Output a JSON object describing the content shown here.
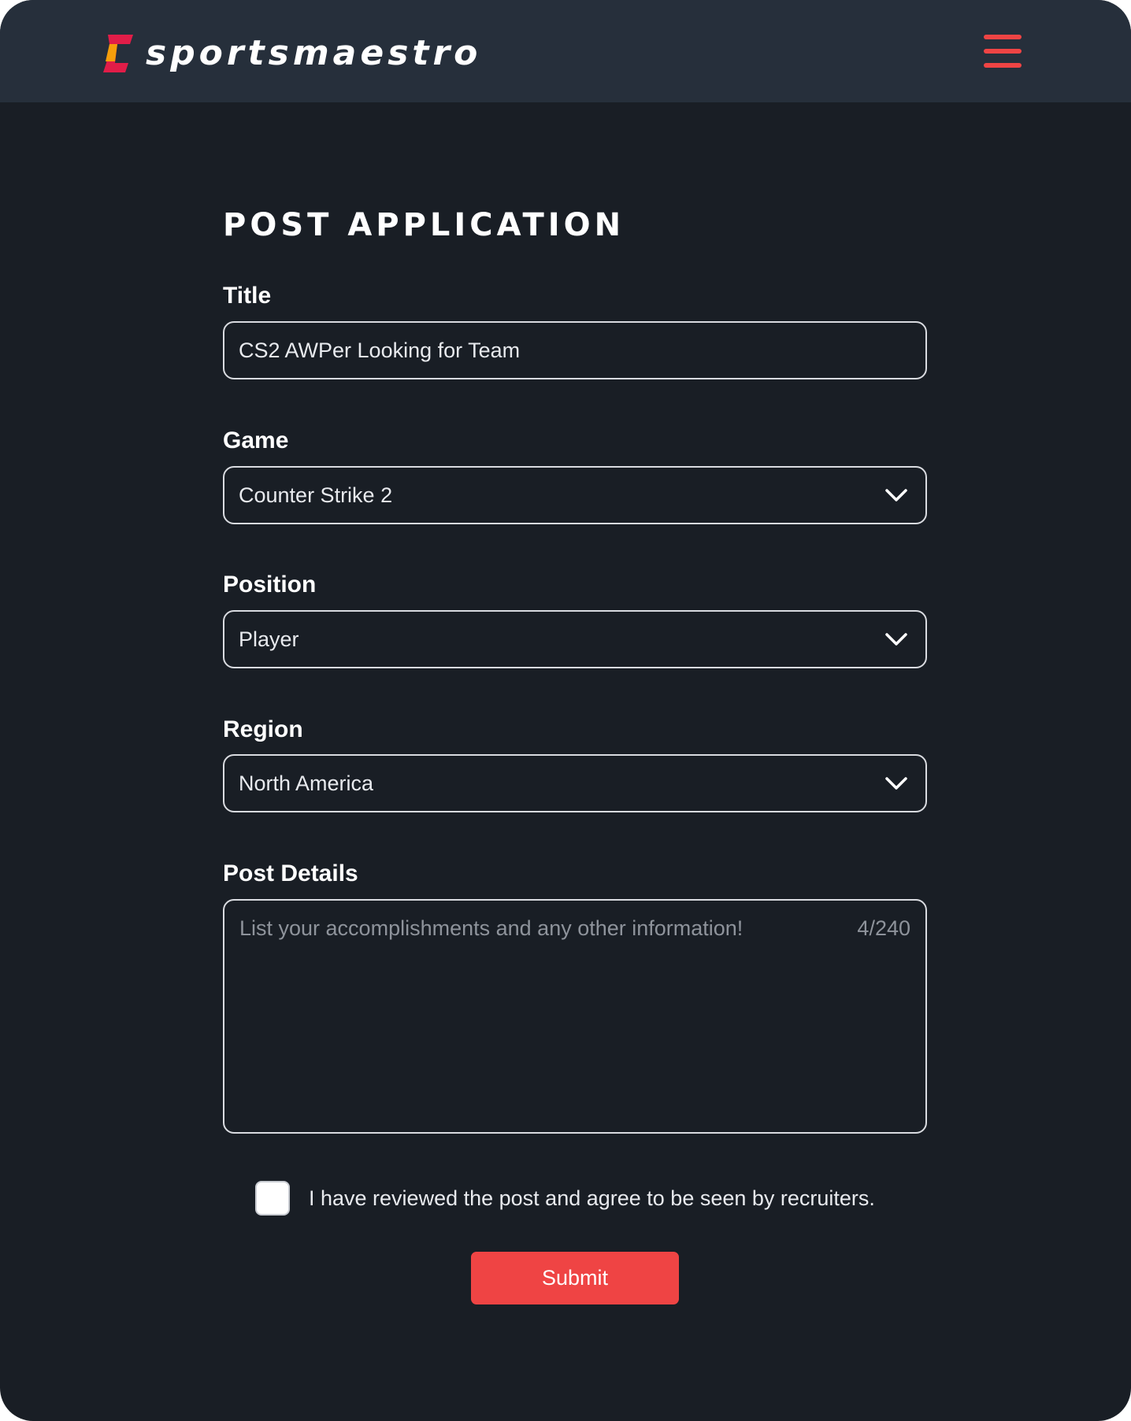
{
  "brand": {
    "name": "sportsmaestro",
    "logo_colors": {
      "primary": "#e11d48",
      "accent": "#f59e0b"
    }
  },
  "header": {
    "menu_icon": "hamburger-menu-icon",
    "menu_color": "#ef4444"
  },
  "page": {
    "title": "POST APPLICATION"
  },
  "form": {
    "title": {
      "label": "Title",
      "value": "CS2 AWPer Looking for Team"
    },
    "game": {
      "label": "Game",
      "value": "Counter Strike 2",
      "icon": "chevron-down-icon"
    },
    "position": {
      "label": "Position",
      "value": "Player",
      "icon": "chevron-down-icon"
    },
    "region": {
      "label": "Region",
      "value": "North America",
      "icon": "chevron-down-icon"
    },
    "details": {
      "label": "Post Details",
      "placeholder": "List your accomplishments and any other information!",
      "counter": "4/240"
    },
    "agree": {
      "label": "I have reviewed the post and agree to be seen by recruiters.",
      "checked": false
    },
    "submit_label": "Submit"
  },
  "colors": {
    "background": "#191e25",
    "header_background": "#262f3b",
    "accent": "#ef4444",
    "field_border": "#d9dbe0",
    "placeholder_text": "#8e939b"
  }
}
